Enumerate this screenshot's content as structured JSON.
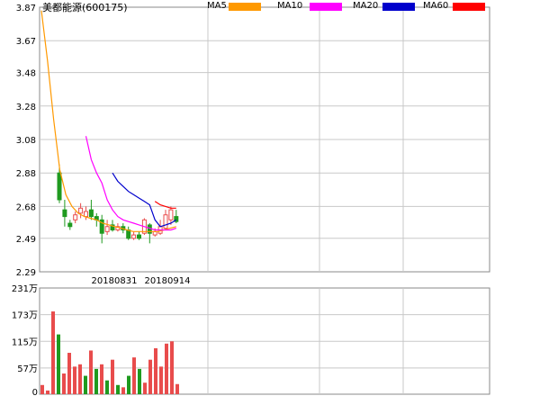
{
  "title": "美都能源(600175)",
  "colors": {
    "up": "#e84c4c",
    "down": "#1f9a1f",
    "grid": "#c8c8c8",
    "border": "#888888"
  },
  "legend": [
    {
      "label": "MA5",
      "color": "#ff9900"
    },
    {
      "label": "MA10",
      "color": "#ff00ff"
    },
    {
      "label": "MA20",
      "color": "#0000cc"
    },
    {
      "label": "MA60",
      "color": "#ff0000"
    }
  ],
  "chart_data": [
    {
      "type": "candlestick",
      "price_ticks": [
        "3.87",
        "3.67",
        "3.48",
        "3.28",
        "3.08",
        "2.88",
        "2.68",
        "2.49",
        "2.29"
      ],
      "ylim": [
        2.29,
        3.87
      ],
      "date_labels": [
        {
          "text": "20180831",
          "index": 10
        },
        {
          "text": "20180914",
          "index": 20
        }
      ],
      "candles": [
        {
          "o": 2.88,
          "c": 2.72,
          "h": 2.93,
          "l": 2.7
        },
        {
          "o": 2.66,
          "c": 2.62,
          "h": 2.72,
          "l": 2.56
        },
        {
          "o": 2.58,
          "c": 2.56,
          "h": 2.6,
          "l": 2.54
        },
        {
          "o": 2.6,
          "c": 2.63,
          "h": 2.65,
          "l": 2.58
        },
        {
          "o": 2.64,
          "c": 2.67,
          "h": 2.7,
          "l": 2.61
        },
        {
          "o": 2.62,
          "c": 2.65,
          "h": 2.68,
          "l": 2.6
        },
        {
          "o": 2.66,
          "c": 2.62,
          "h": 2.72,
          "l": 2.6
        },
        {
          "o": 2.62,
          "c": 2.6,
          "h": 2.64,
          "l": 2.56
        },
        {
          "o": 2.6,
          "c": 2.52,
          "h": 2.63,
          "l": 2.46
        },
        {
          "o": 2.53,
          "c": 2.56,
          "h": 2.6,
          "l": 2.51
        },
        {
          "o": 2.57,
          "c": 2.54,
          "h": 2.6,
          "l": 2.53
        },
        {
          "o": 2.54,
          "c": 2.56,
          "h": 2.58,
          "l": 2.53
        },
        {
          "o": 2.56,
          "c": 2.54,
          "h": 2.58,
          "l": 2.52
        },
        {
          "o": 2.54,
          "c": 2.49,
          "h": 2.56,
          "l": 2.48
        },
        {
          "o": 2.49,
          "c": 2.51,
          "h": 2.53,
          "l": 2.48
        },
        {
          "o": 2.51,
          "c": 2.49,
          "h": 2.53,
          "l": 2.48
        },
        {
          "o": 2.52,
          "c": 2.6,
          "h": 2.61,
          "l": 2.51
        },
        {
          "o": 2.57,
          "c": 2.52,
          "h": 2.58,
          "l": 2.46
        },
        {
          "o": 2.51,
          "c": 2.53,
          "h": 2.55,
          "l": 2.5
        },
        {
          "o": 2.52,
          "c": 2.56,
          "h": 2.6,
          "l": 2.51
        },
        {
          "o": 2.55,
          "c": 2.63,
          "h": 2.66,
          "l": 2.54
        },
        {
          "o": 2.6,
          "c": 2.66,
          "h": 2.68,
          "l": 2.57
        },
        {
          "o": 2.62,
          "c": 2.59,
          "h": 2.66,
          "l": 2.58
        }
      ],
      "ma5": [
        3.85,
        3.55,
        3.2,
        2.9,
        2.75,
        2.68,
        2.64,
        2.62,
        2.61,
        2.6,
        2.58,
        2.57,
        2.56,
        2.55,
        2.54,
        2.53,
        2.53,
        2.53,
        2.53,
        2.53,
        2.54,
        2.55,
        2.56
      ],
      "ma10": [
        null,
        null,
        null,
        null,
        null,
        3.1,
        2.96,
        2.88,
        2.82,
        2.72,
        2.66,
        2.62,
        2.6,
        2.59,
        2.58,
        2.57,
        2.56,
        2.55,
        2.54,
        2.54,
        2.54,
        2.54,
        2.55
      ],
      "ma20": [
        null,
        null,
        null,
        null,
        null,
        null,
        null,
        null,
        null,
        null,
        2.88,
        2.83,
        2.8,
        2.77,
        2.75,
        2.73,
        2.71,
        2.69,
        2.6,
        2.56,
        2.57,
        2.58,
        2.6
      ],
      "ma60": [
        null,
        null,
        null,
        null,
        null,
        null,
        null,
        null,
        null,
        null,
        null,
        null,
        null,
        null,
        null,
        null,
        null,
        null,
        2.71,
        2.69,
        2.68,
        2.67,
        2.67
      ],
      "vol_ticks": [
        "231万",
        "173万",
        "115万",
        "57万",
        "0"
      ],
      "vol_ylim": [
        0,
        231
      ],
      "volumes": [
        20,
        8,
        180,
        130,
        45,
        90,
        60,
        65,
        40,
        95,
        55,
        65,
        30,
        75,
        20,
        15,
        40,
        80,
        55,
        25,
        75,
        100,
        60,
        110,
        115,
        22
      ]
    }
  ]
}
